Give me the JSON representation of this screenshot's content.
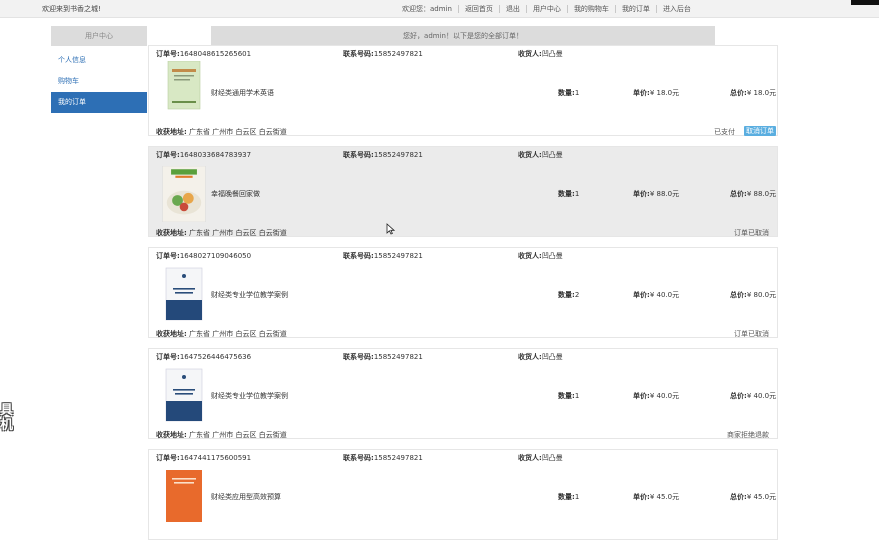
{
  "topbar": {
    "welcome": "欢迎来到书香之城!",
    "user_greeting": "欢迎您：admin",
    "nav": [
      "返回首页",
      "退出",
      "用户中心",
      "我的购物车",
      "我的订单",
      "进入后台"
    ]
  },
  "sidebar": {
    "header": "用户中心",
    "items": [
      "个人信息",
      "购物车",
      "我的订单"
    ]
  },
  "greeting_banner": "您好，admin！以下是您的全部订单！",
  "labels": {
    "order_no": "订单号:",
    "phone": "联系号码:",
    "receiver": "收货人:",
    "address": "收获地址:",
    "qty": "数量:",
    "price": "单价:",
    "total": "总价:",
    "cancel_button": "取消订单"
  },
  "orders": [
    {
      "order_no": "1648048615265601",
      "phone": "15852497821",
      "receiver": "凹凸曼",
      "book": "财经类通用学术英语",
      "qty": "1",
      "price": "¥ 18.0元",
      "total": "¥ 18.0元",
      "address": "广东省 广州市 白云区 白云街道",
      "status": "已支付"
    },
    {
      "order_no": "1648033684783937",
      "phone": "15852497821",
      "receiver": "凹凸曼",
      "book": "幸福晚餐回家做",
      "qty": "1",
      "price": "¥ 88.0元",
      "total": "¥ 88.0元",
      "address": "广东省 广州市 白云区 白云街道",
      "status": "订单已取消"
    },
    {
      "order_no": "1648027109046050",
      "phone": "15852497821",
      "receiver": "凹凸曼",
      "book": "财经类专业学位教学案例",
      "qty": "2",
      "price": "¥ 40.0元",
      "total": "¥ 80.0元",
      "address": "广东省 广州市 白云区 白云街道",
      "status": "订单已取消"
    },
    {
      "order_no": "1647526446475636",
      "phone": "15852497821",
      "receiver": "凹凸曼",
      "book": "财经类专业学位教学案例",
      "qty": "1",
      "price": "¥ 40.0元",
      "total": "¥ 40.0元",
      "address": "广东省 广州市 白云区 白云街道",
      "status": "商家拒绝退款"
    },
    {
      "order_no": "1647441175600591",
      "phone": "15852497821",
      "receiver": "凹凸曼",
      "book": "财经类应用型高效预算",
      "qty": "1",
      "price": "¥ 45.0元",
      "total": "¥ 45.0元"
    }
  ],
  "watermark_text": "具机",
  "colors": {
    "accent": "#2d6fb5",
    "button": "#5aaee0",
    "panel": "#dcdcdc"
  }
}
